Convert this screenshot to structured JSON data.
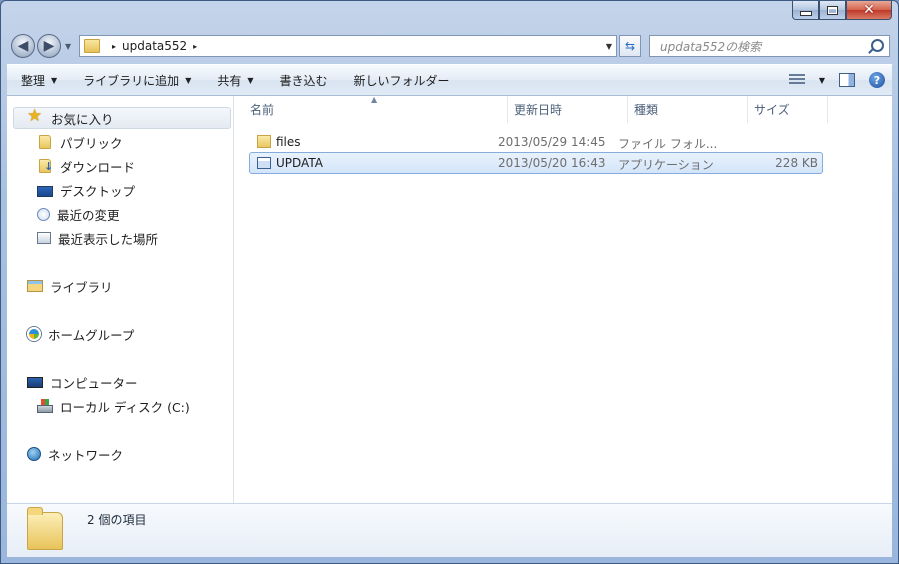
{
  "window": {
    "caption_buttons": {
      "minimize": "minimize",
      "maximize": "maximize",
      "close": "✕"
    }
  },
  "address_bar": {
    "crumbs": [
      "updata552"
    ],
    "separator": "▸"
  },
  "search": {
    "placeholder": "updata552の検索"
  },
  "toolbar": {
    "items": [
      {
        "label": "整理",
        "has_dropdown": true
      },
      {
        "label": "ライブラリに追加",
        "has_dropdown": true
      },
      {
        "label": "共有",
        "has_dropdown": true
      },
      {
        "label": "書き込む",
        "has_dropdown": false
      },
      {
        "label": "新しいフォルダー",
        "has_dropdown": false
      }
    ],
    "dropdown_glyph": "▼",
    "help_glyph": "?"
  },
  "sidebar": {
    "favorites": "お気に入り",
    "favorites_items": [
      "パブリック",
      "ダウンロード",
      "デスクトップ",
      "最近の変更",
      "最近表示した場所"
    ],
    "libraries": "ライブラリ",
    "homegroup": "ホームグループ",
    "computer": "コンピューター",
    "computer_items": [
      "ローカル ディスク (C:)"
    ],
    "network": "ネットワーク"
  },
  "file_list": {
    "columns": [
      "名前",
      "更新日時",
      "種類",
      "サイズ"
    ],
    "rows": [
      {
        "name": "files",
        "modified": "2013/05/29 14:45",
        "type": "ファイル フォル...",
        "size": "",
        "icon": "folder-icon"
      },
      {
        "name": "UPDATA",
        "modified": "2013/05/20 16:43",
        "type": "アプリケーション",
        "size": "228 KB",
        "icon": "application-icon",
        "selected": true
      }
    ]
  },
  "details_pane": {
    "item_count": "2 個の項目"
  },
  "colors": {
    "selection": "#d3e5fa",
    "selection_border": "#84acdd",
    "toolbar": "#e4ecf6"
  }
}
